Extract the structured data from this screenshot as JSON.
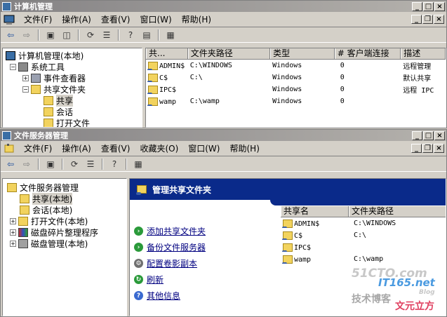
{
  "window1": {
    "title": "计算机管理",
    "menu": [
      "文件(F)",
      "操作(A)",
      "查看(V)",
      "窗口(W)",
      "帮助(H)"
    ],
    "tree": {
      "root": "计算机管理(本地)",
      "system_tools": "系统工具",
      "event_viewer": "事件查看器",
      "shared_folders": "共享文件夹",
      "shares": "共享",
      "sessions": "会话",
      "open_files": "打开文件"
    },
    "columns": [
      "共...",
      "文件夹路径",
      "类型",
      "# 客户端连接",
      "描述"
    ],
    "rows": [
      {
        "name": "ADMIN$",
        "path": "C:\\WINDOWS",
        "type": "Windows",
        "clients": "0",
        "desc": "远程管理"
      },
      {
        "name": "C$",
        "path": "C:\\",
        "type": "Windows",
        "clients": "0",
        "desc": "默认共享"
      },
      {
        "name": "IPC$",
        "path": "",
        "type": "Windows",
        "clients": "0",
        "desc": "远程 IPC"
      },
      {
        "name": "wamp",
        "path": "C:\\wamp",
        "type": "Windows",
        "clients": "0",
        "desc": ""
      }
    ]
  },
  "window2": {
    "title": "文件服务器管理",
    "menu": [
      "文件(F)",
      "操作(A)",
      "查看(V)",
      "收藏夹(O)",
      "窗口(W)",
      "帮助(H)"
    ],
    "tree": {
      "root": "文件服务器管理",
      "shares": "共享(本地)",
      "sessions": "会话(本地)",
      "open_files": "打开文件(本地)",
      "defrag": "磁盘碎片整理程序",
      "disk_mgmt": "磁盘管理(本地)"
    },
    "task_header": "管理共享文件夹",
    "tasks": [
      "添加共享文件夹",
      "备份文件服务器",
      "配置卷影副本",
      "刷新",
      "其他信息"
    ],
    "columns": [
      "共享名",
      "文件夹路径"
    ],
    "rows": [
      {
        "name": "ADMIN$",
        "path": "C:\\WINDOWS"
      },
      {
        "name": "C$",
        "path": "C:\\"
      },
      {
        "name": "IPC$",
        "path": ""
      },
      {
        "name": "wamp",
        "path": "C:\\wamp"
      }
    ]
  },
  "watermark": {
    "site1": "51CTO.com",
    "sub1": "技术博客",
    "site2": "IT165.net",
    "sub2": "文元立方",
    "blog": "Blog"
  }
}
